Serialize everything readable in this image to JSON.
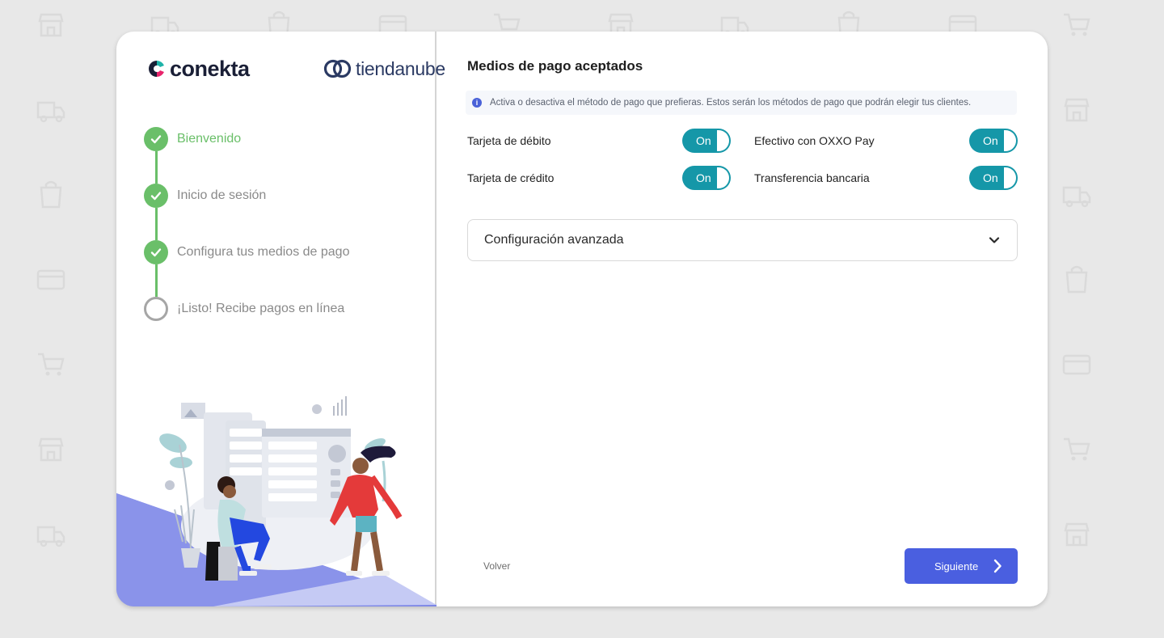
{
  "brand": {
    "conekta": "conekta",
    "tiendanube": "tiendanube",
    "conekta_colors": [
      "#1fb3a9",
      "#e8246c",
      "#4a5fe0"
    ]
  },
  "steps": [
    {
      "label": "Bienvenido",
      "status": "done",
      "active": true
    },
    {
      "label": "Inicio de sesión",
      "status": "done",
      "active": false
    },
    {
      "label": "Configura tus medios de pago",
      "status": "done",
      "active": false
    },
    {
      "label": "¡Listo! Recibe pagos en línea",
      "status": "pending",
      "active": false
    }
  ],
  "main": {
    "title": "Medios de pago aceptados",
    "info": "Activa o desactiva el método de pago que prefieras. Estos serán los métodos de pago que podrán elegir tus clientes.",
    "methods": [
      {
        "name": "Tarjeta de débito",
        "toggle": "On",
        "enabled": true
      },
      {
        "name": "Efectivo con OXXO Pay",
        "toggle": "On",
        "enabled": true
      },
      {
        "name": "Tarjeta de crédito",
        "toggle": "On",
        "enabled": true
      },
      {
        "name": "Transferencia bancaria",
        "toggle": "On",
        "enabled": true
      }
    ],
    "advanced": "Configuración avanzada",
    "back": "Volver",
    "next": "Siguiente"
  },
  "colors": {
    "accent": "#4a5fe0",
    "toggle": "#1597a8",
    "success": "#6abf69"
  },
  "icons": {
    "info": "info-icon",
    "chevron": "chevron-down-icon",
    "next": "chevron-right-icon",
    "check": "check-icon"
  }
}
